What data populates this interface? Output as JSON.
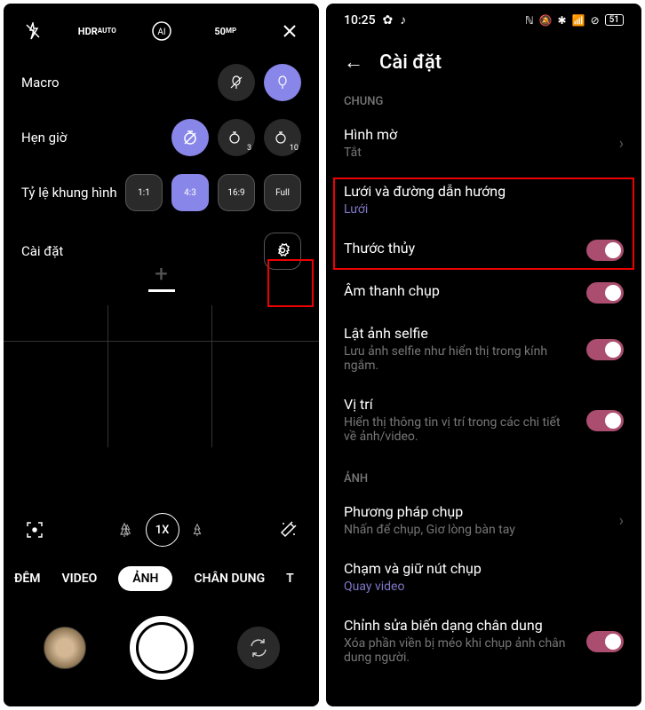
{
  "left": {
    "topIcons": {
      "hdr_main": "HDR",
      "hdr_sub": "AUTO",
      "ai": "AI",
      "fifty": "50",
      "fifty_sub": "MP"
    },
    "options": {
      "macro": "Macro",
      "timer": "Hẹn giờ",
      "timer_3": "3",
      "timer_10": "10",
      "ratio": "Tỷ lệ khung hình",
      "ratio_11": "1:1",
      "ratio_43": "4:3",
      "ratio_169": "16:9",
      "ratio_full": "Full",
      "settings": "Cài đặt"
    },
    "zoom": "1X",
    "modes": {
      "night": "ĐÊM",
      "video": "VIDEO",
      "photo": "ẢNH",
      "portrait": "CHÂN DUNG",
      "more": "T"
    }
  },
  "right": {
    "status": {
      "time": "10:25",
      "battery": "51"
    },
    "header": "Cài đặt",
    "section_general": "CHUNG",
    "watermark": {
      "title": "Hình mờ",
      "sub": "Tắt"
    },
    "grid": {
      "title": "Lưới và đường dẫn hướng",
      "sub": "Lưới"
    },
    "level": {
      "title": "Thước thủy"
    },
    "shutter_sound": {
      "title": "Âm thanh chụp"
    },
    "selfie_flip": {
      "title": "Lật ảnh selfie",
      "sub": "Lưu ảnh selfie như hiển thị trong kính ngắm."
    },
    "location": {
      "title": "Vị trí",
      "sub": "Hiển thị thông tin vị trí trong các chi tiết về ảnh/video."
    },
    "section_photo": "ẢNH",
    "capture_method": {
      "title": "Phương pháp chụp",
      "sub": "Nhấn để chụp, Giơ lòng bàn tay"
    },
    "hold_shutter": {
      "title": "Chạm và giữ nút chụp",
      "sub": "Quay video"
    },
    "portrait_fix": {
      "title": "Chỉnh sửa biến dạng chân dung",
      "sub": "Xóa phần viền bị méo khi chụp ảnh chân dung người."
    }
  }
}
